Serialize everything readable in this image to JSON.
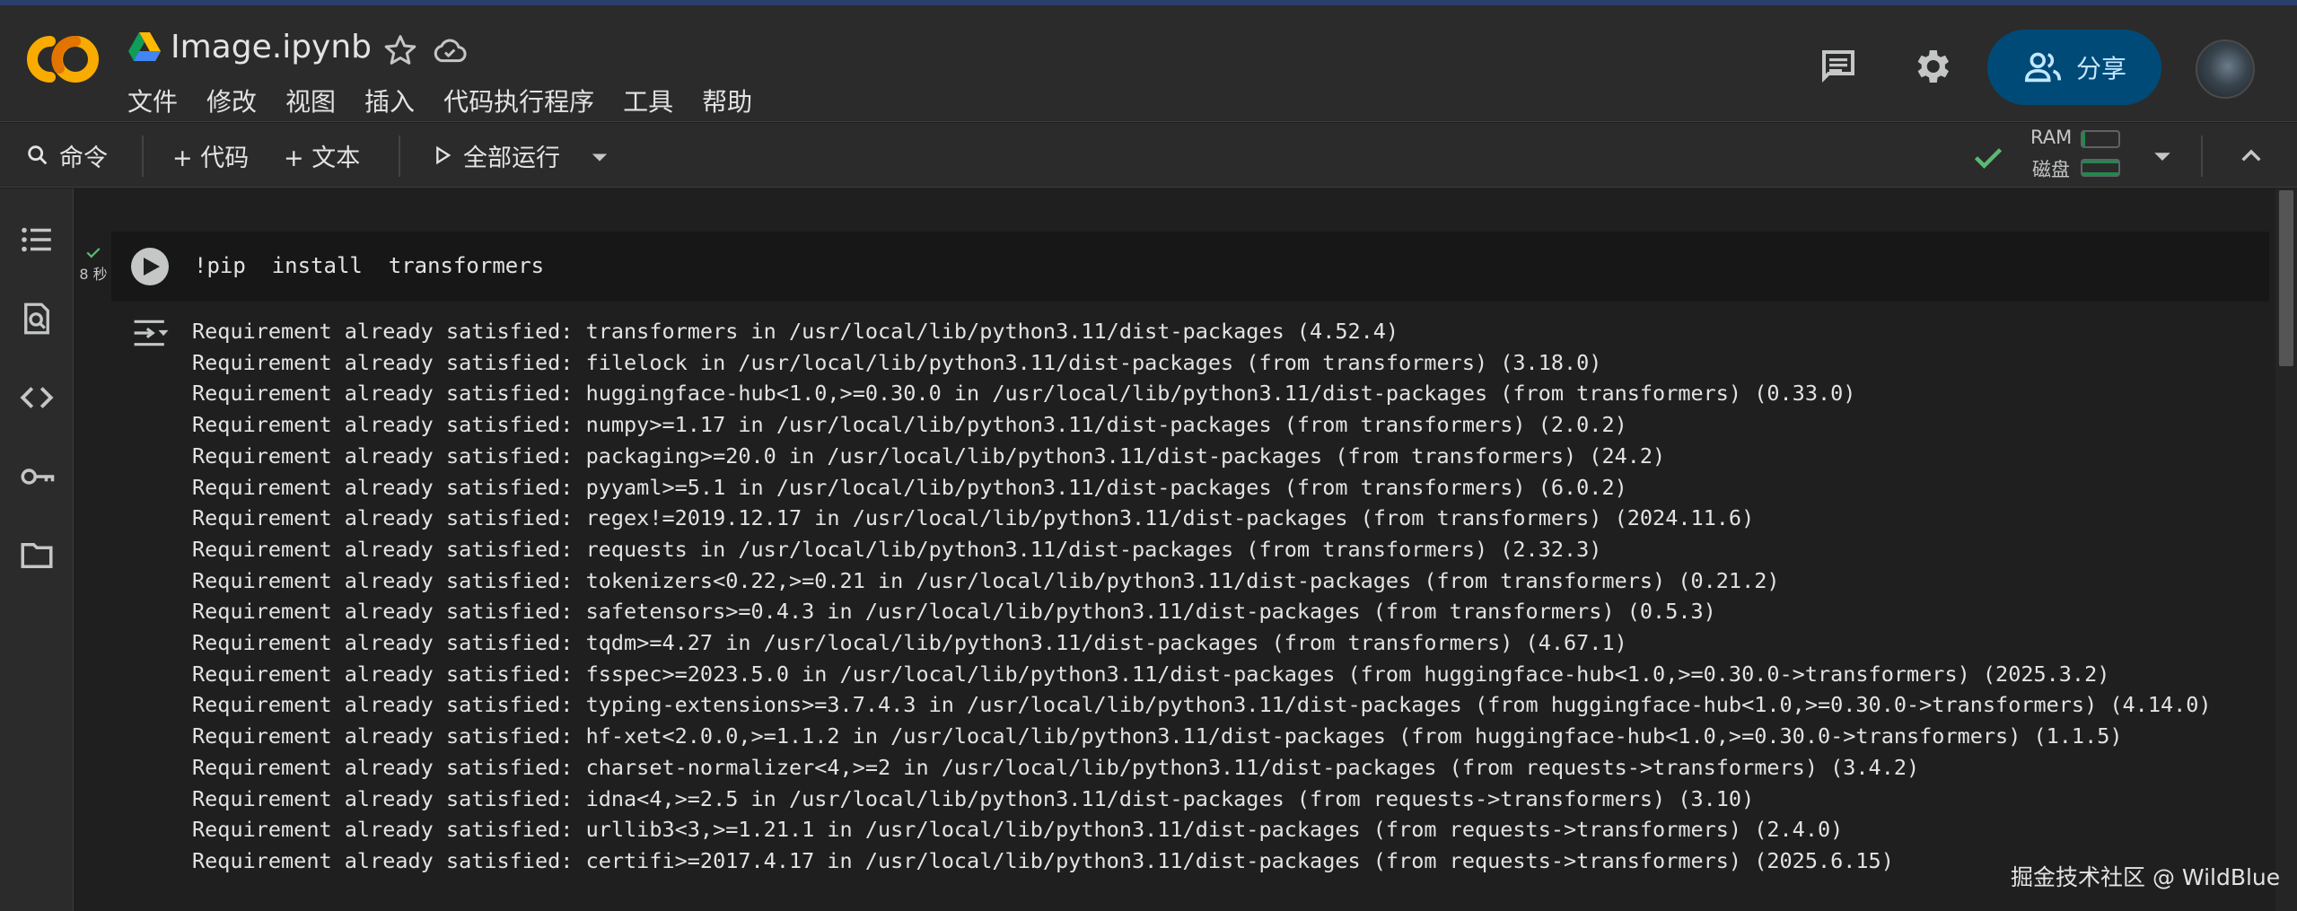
{
  "header": {
    "title": "Image.ipynb",
    "menu": [
      "文件",
      "修改",
      "视图",
      "插入",
      "代码执行程序",
      "工具",
      "帮助"
    ],
    "share_label": "分享"
  },
  "toolbar": {
    "command_label": "命令",
    "add_code_label": "+ 代码",
    "add_text_label": "+ 文本",
    "run_all_label": "全部运行",
    "ram_label": "RAM",
    "disk_label": "磁盘"
  },
  "cell": {
    "code": "!pip  install  transformers",
    "exec_time": "8 秒",
    "output": [
      "Requirement already satisfied: transformers in /usr/local/lib/python3.11/dist-packages (4.52.4)",
      "Requirement already satisfied: filelock in /usr/local/lib/python3.11/dist-packages (from transformers) (3.18.0)",
      "Requirement already satisfied: huggingface-hub<1.0,>=0.30.0 in /usr/local/lib/python3.11/dist-packages (from transformers) (0.33.0)",
      "Requirement already satisfied: numpy>=1.17 in /usr/local/lib/python3.11/dist-packages (from transformers) (2.0.2)",
      "Requirement already satisfied: packaging>=20.0 in /usr/local/lib/python3.11/dist-packages (from transformers) (24.2)",
      "Requirement already satisfied: pyyaml>=5.1 in /usr/local/lib/python3.11/dist-packages (from transformers) (6.0.2)",
      "Requirement already satisfied: regex!=2019.12.17 in /usr/local/lib/python3.11/dist-packages (from transformers) (2024.11.6)",
      "Requirement already satisfied: requests in /usr/local/lib/python3.11/dist-packages (from transformers) (2.32.3)",
      "Requirement already satisfied: tokenizers<0.22,>=0.21 in /usr/local/lib/python3.11/dist-packages (from transformers) (0.21.2)",
      "Requirement already satisfied: safetensors>=0.4.3 in /usr/local/lib/python3.11/dist-packages (from transformers) (0.5.3)",
      "Requirement already satisfied: tqdm>=4.27 in /usr/local/lib/python3.11/dist-packages (from transformers) (4.67.1)",
      "Requirement already satisfied: fsspec>=2023.5.0 in /usr/local/lib/python3.11/dist-packages (from huggingface-hub<1.0,>=0.30.0->transformers) (2025.3.2)",
      "Requirement already satisfied: typing-extensions>=3.7.4.3 in /usr/local/lib/python3.11/dist-packages (from huggingface-hub<1.0,>=0.30.0->transformers) (4.14.0)",
      "Requirement already satisfied: hf-xet<2.0.0,>=1.1.2 in /usr/local/lib/python3.11/dist-packages (from huggingface-hub<1.0,>=0.30.0->transformers) (1.1.5)",
      "Requirement already satisfied: charset-normalizer<4,>=2 in /usr/local/lib/python3.11/dist-packages (from requests->transformers) (3.4.2)",
      "Requirement already satisfied: idna<4,>=2.5 in /usr/local/lib/python3.11/dist-packages (from requests->transformers) (3.10)",
      "Requirement already satisfied: urllib3<3,>=1.21.1 in /usr/local/lib/python3.11/dist-packages (from requests->transformers) (2.4.0)",
      "Requirement already satisfied: certifi>=2017.4.17 in /usr/local/lib/python3.11/dist-packages (from requests->transformers) (2025.6.15)"
    ]
  },
  "watermark": "掘金技术社区 @ WildBlue",
  "colors": {
    "background": "#1f1f1f",
    "header_bg": "#2b2b2b",
    "share_bg": "#004a77",
    "share_fg": "#c2e7ff",
    "logo_orange": "#f9ab00",
    "logo_dark_orange": "#e37400",
    "success_green": "#5bb974"
  },
  "icons": {
    "search": "search-icon",
    "star": "star-icon",
    "cloud": "cloud-icon",
    "comment": "comment-icon",
    "gear": "gear-icon",
    "share": "people-icon",
    "rail": [
      "toc-icon",
      "find-replace-icon",
      "code-snippets-icon",
      "key-icon",
      "folder-icon"
    ]
  }
}
